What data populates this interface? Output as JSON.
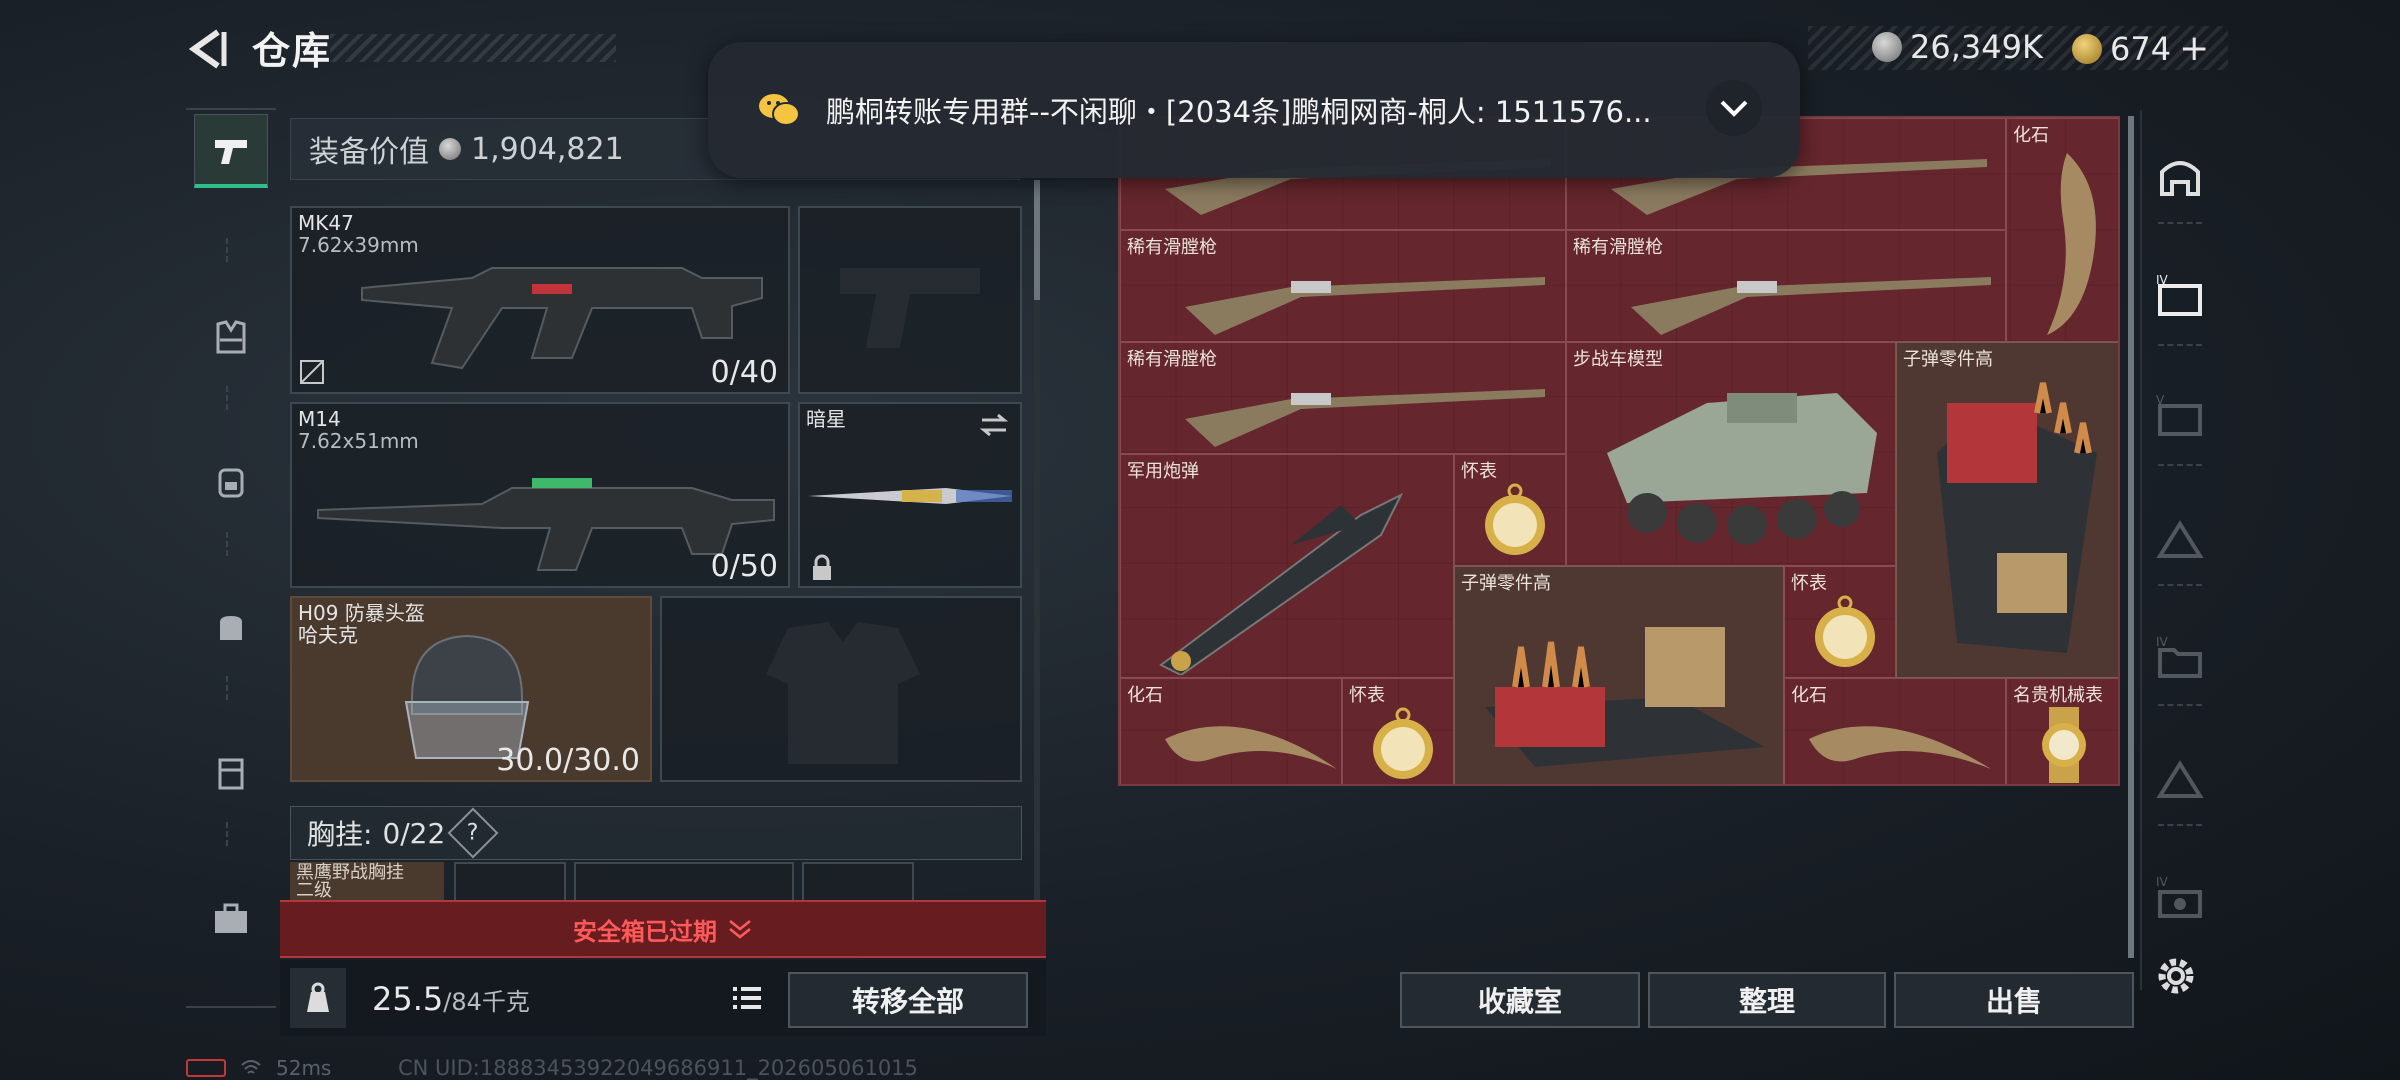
{
  "header": {
    "title": "仓库",
    "currency_silver": "26,349K",
    "currency_gold": "674",
    "currency_add": "+"
  },
  "notification": {
    "text": "鹏桐转账专用群--不闲聊・[2034条]鹏桐网商-桐人: 1511576..."
  },
  "equipment": {
    "value_label": "装备价值",
    "value": "1,904,821",
    "primary": {
      "name": "MK47",
      "caliber": "7.62x39mm",
      "ammo": "0/40"
    },
    "secondary": {
      "name": "M14",
      "caliber": "7.62x51mm",
      "ammo": "0/50"
    },
    "melee": {
      "name": "暗星"
    },
    "helmet": {
      "name": "H09 防暴头盔",
      "sub": "哈夫克",
      "durability": "30.0/30.0"
    },
    "chest_rig": {
      "label": "胸挂:",
      "count": "0/22",
      "help": "?",
      "item_name": "黑鹰野战胸挂",
      "item_sub": "二级"
    },
    "safebox": "安全箱已过期",
    "weight": "25.5",
    "weight_max": "/84千克",
    "transfer_all": "转移全部"
  },
  "storage": {
    "items": [
      {
        "name": "化石"
      },
      {
        "name": "稀有滑膛枪"
      },
      {
        "name": "稀有滑膛枪"
      },
      {
        "name": "稀有滑膛枪"
      },
      {
        "name": "步战车模型"
      },
      {
        "name": "子弹零件高"
      },
      {
        "name": "军用炮弹"
      },
      {
        "name": "怀表"
      },
      {
        "name": "子弹零件高"
      },
      {
        "name": "怀表"
      },
      {
        "name": "化石"
      },
      {
        "name": "怀表"
      },
      {
        "name": "化石"
      },
      {
        "name": "名贵机械表"
      }
    ],
    "buttons": {
      "collection": "收藏室",
      "sort": "整理",
      "sell": "出售"
    }
  },
  "right_rail": {
    "levels": [
      "IV",
      "V",
      "IV",
      "IV"
    ]
  },
  "status": {
    "ping": "52ms",
    "uid": "CN UID:18883453922049686911_202605061015"
  },
  "colors": {
    "accent_green": "#2fbf8a",
    "storage_red": "#6b2a31",
    "warning_red": "#ff5a5a"
  }
}
